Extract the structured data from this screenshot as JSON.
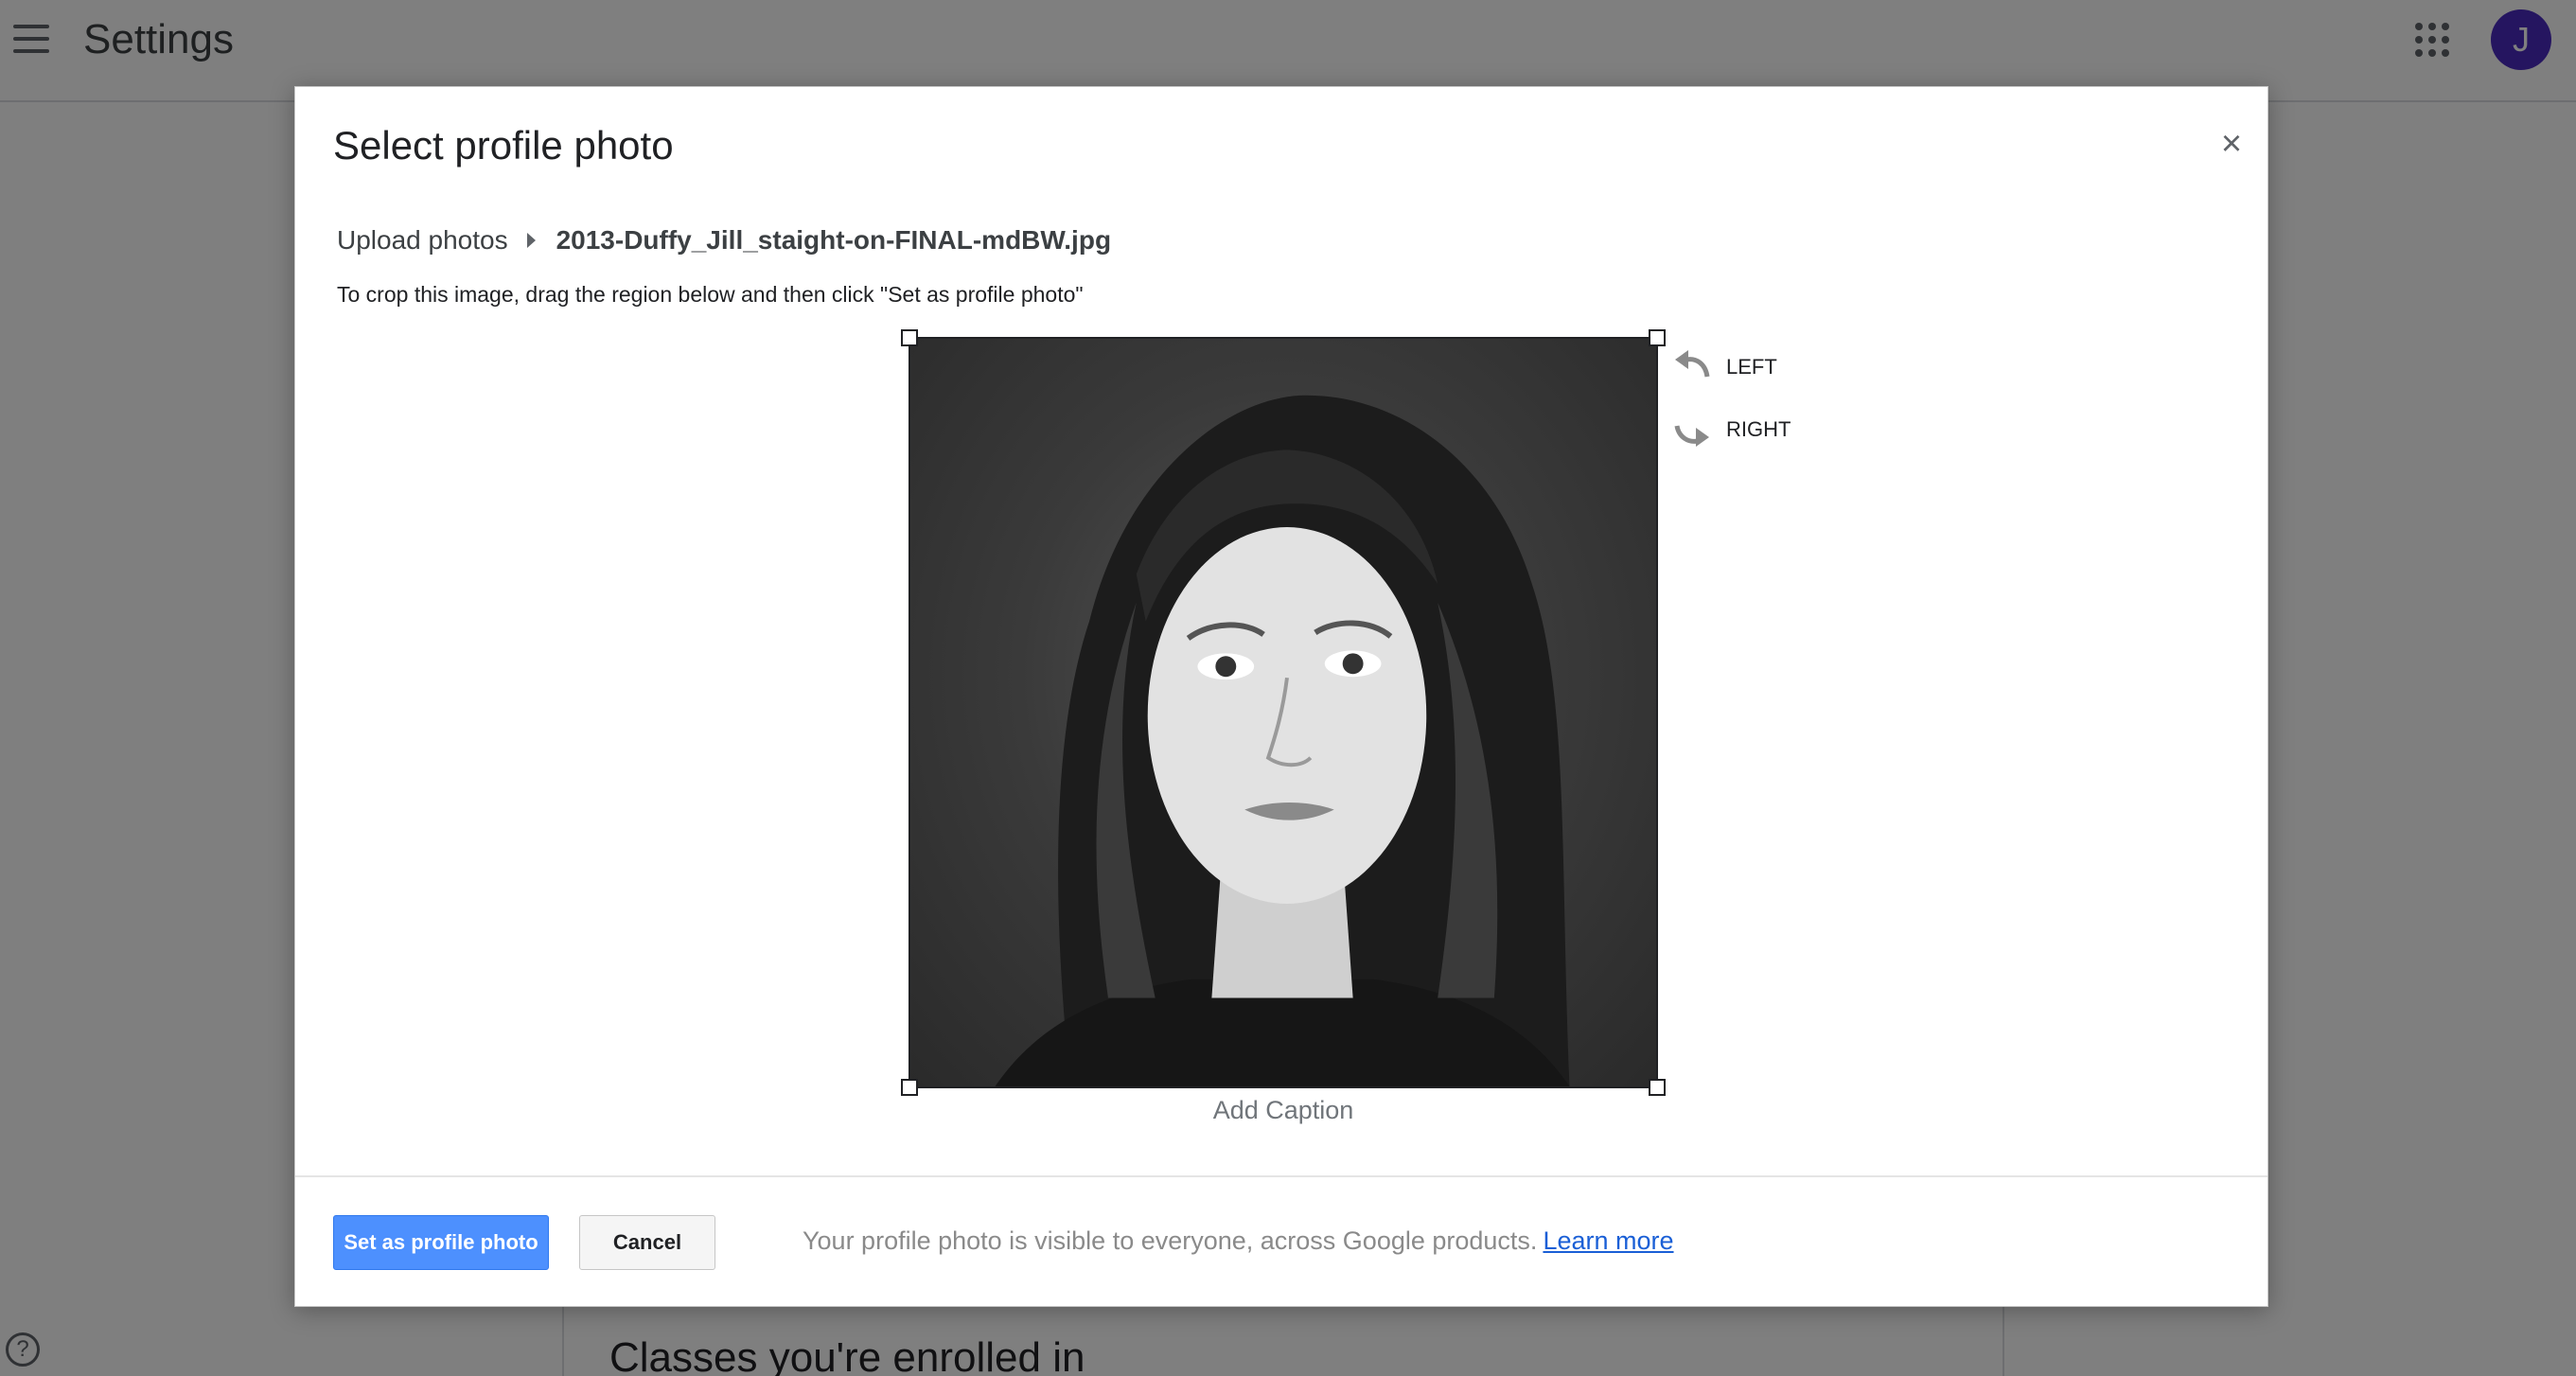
{
  "page": {
    "title": "Settings",
    "avatar_initial": "J",
    "section_heading": "Classes you're enrolled in",
    "help_glyph": "?"
  },
  "dialog": {
    "title": "Select profile photo",
    "close_glyph": "×",
    "breadcrumb": {
      "root": "Upload photos",
      "current": "2013-Duffy_Jill_staight-on-FINAL-mdBW.jpg"
    },
    "instruction": "To crop this image, drag the region below and then click \"Set as profile photo\"",
    "rotate": {
      "left_label": "LEFT",
      "right_label": "RIGHT"
    },
    "caption": "Add Caption",
    "footer": {
      "primary_button": "Set as profile photo",
      "cancel_button": "Cancel",
      "note": "Your profile photo is visible to everyone, across Google products.",
      "learn_more": "Learn more"
    }
  },
  "colors": {
    "primary_button": "#4d90fe",
    "avatar": "#4a2ac0",
    "link": "#1a5fd6",
    "overlay": "rgba(0,0,0,0.5)"
  },
  "icons": [
    "menu-icon",
    "apps-grid-icon",
    "close-icon",
    "chevron-right-icon",
    "rotate-left-icon",
    "rotate-right-icon",
    "help-icon"
  ]
}
